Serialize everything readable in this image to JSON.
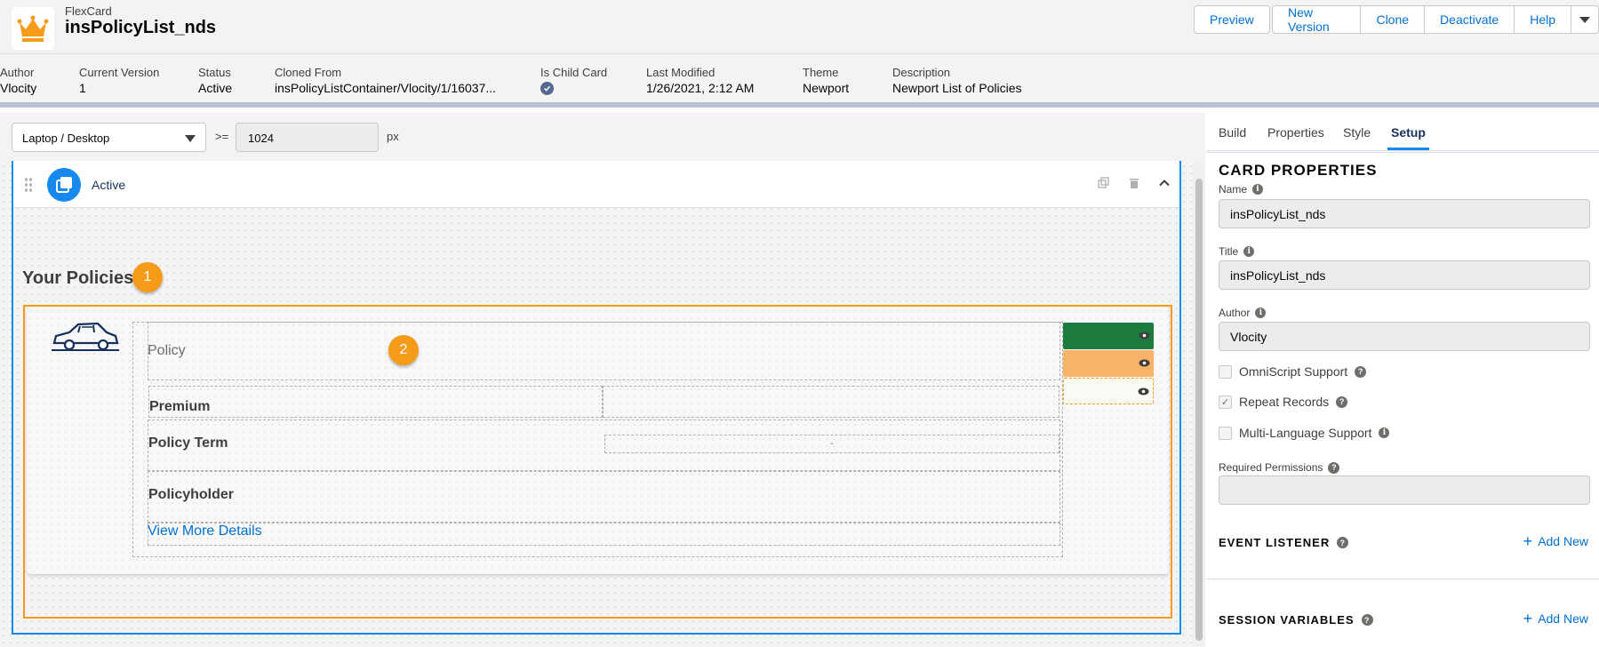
{
  "header": {
    "app_type": "FlexCard",
    "title": "insPolicyList_nds",
    "actions": [
      "Preview",
      "New Version",
      "Clone",
      "Deactivate",
      "Help"
    ]
  },
  "meta": {
    "author_label": "Author",
    "author": "Vlocity",
    "version_label": "Current Version",
    "version": "1",
    "status_label": "Status",
    "status": "Active",
    "cloned_label": "Cloned From",
    "cloned": "insPolicyListContainer/Vlocity/1/16037...",
    "child_label": "Is Child Card",
    "modified_label": "Last Modified",
    "modified": "1/26/2021, 2:12 AM",
    "theme_label": "Theme",
    "theme": "Newport",
    "desc_label": "Description",
    "desc": "Newport List of Policies"
  },
  "canvas": {
    "device": "Laptop / Desktop",
    "operator": ">=",
    "width_value": "1024",
    "unit": "px",
    "state_name": "Active",
    "heading": "Your Policies",
    "badge1": "1",
    "badge2": "2",
    "fields": {
      "policy": "Policy",
      "premium": "Premium",
      "policy_term": "Policy Term",
      "policy_term_value": "-",
      "policyholder": "Policyholder",
      "view_more": "View More Details"
    },
    "action_colors": [
      "#1c7c3f",
      "#f7b367",
      "#fafaf7"
    ]
  },
  "panel": {
    "tabs": [
      "Build",
      "Properties",
      "Style",
      "Setup"
    ],
    "active_tab": "Setup",
    "section_title": "CARD PROPERTIES",
    "name_label": "Name",
    "name_value": "insPolicyList_nds",
    "title_label": "Title",
    "title_value": "insPolicyList_nds",
    "author_label": "Author",
    "author_value": "Vlocity",
    "omniscript_label": "OmniScript Support",
    "repeat_label": "Repeat Records",
    "multilang_label": "Multi-Language Support",
    "perm_label": "Required Permissions",
    "event_label": "EVENT LISTENER",
    "session_label": "SESSION VARIABLES",
    "add_new": "Add New"
  }
}
